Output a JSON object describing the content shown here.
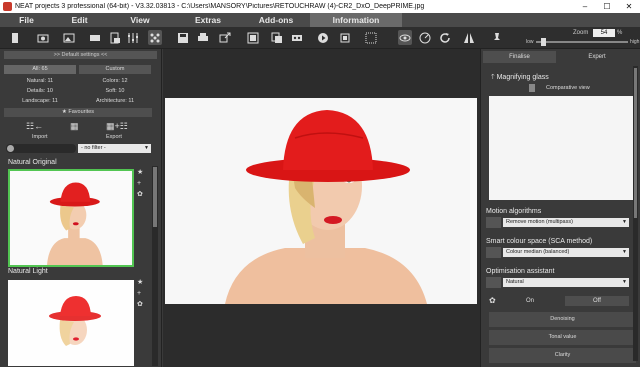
{
  "window": {
    "title": "NEAT projects 3 professional (64-bit) - V3.32.03813 - C:\\Users\\MANSORY\\Pictures\\RETOUCHRAW (4)-CR2_DxO_DeepPRIME.jpg",
    "minimize": "–",
    "maximize": "☐",
    "close": "✕"
  },
  "menu": [
    "File",
    "Edit",
    "View",
    "Extras",
    "Add-ons",
    "Information"
  ],
  "zoom": {
    "label": "Zoom",
    "value": "54",
    "unit": "%",
    "low": "low",
    "high": "high"
  },
  "left": {
    "settings_header": ">> Default settings <<",
    "counts": {
      "all": "All: 65",
      "custom": "Custom",
      "natural": "Natural: 11",
      "colors": "Colors: 12",
      "details": "Details: 10",
      "soft": "Soft: 10",
      "landscape": "Landscape: 11",
      "architecture": "Architecture: 11"
    },
    "favourites": "★  Favourites",
    "import": "Import",
    "export": "Export",
    "filter": "- no filter -",
    "presets": [
      {
        "title": "Natural Original"
      },
      {
        "title": "Natural Light"
      }
    ]
  },
  "right": {
    "tabs": {
      "finalise": "Finalise",
      "expert": "Expert"
    },
    "magnifying": "Magnifying glass",
    "comparative": "Comparative view",
    "motion": {
      "title": "Motion algorithms",
      "value": "Remove motion (multipass)"
    },
    "sca": {
      "title": "Smart colour space (SCA method)",
      "value": "Colour median (balanced)"
    },
    "assistant": {
      "title": "Optimisation assistant",
      "value": "Natural"
    },
    "on": "On",
    "off": "Off",
    "list": [
      "Denoising",
      "Tonal value",
      "Clarity"
    ]
  },
  "colors": {
    "accent": "#52c552",
    "hat": "#e01a1a",
    "hair": "#e9c98c",
    "skin": "#f0c7a8"
  }
}
